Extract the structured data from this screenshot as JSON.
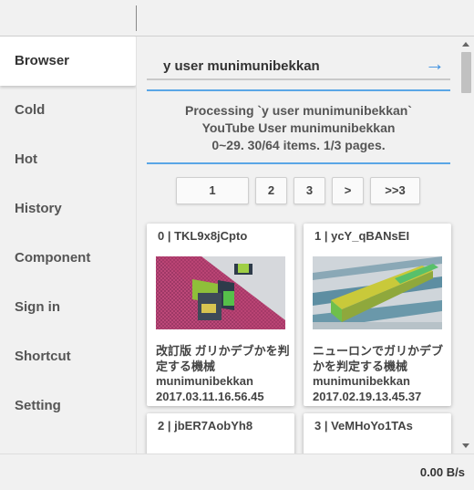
{
  "sidebar": {
    "items": [
      {
        "label": "Browser"
      },
      {
        "label": "Cold"
      },
      {
        "label": "Hot"
      },
      {
        "label": "History"
      },
      {
        "label": "Component"
      },
      {
        "label": "Sign in"
      },
      {
        "label": "Shortcut"
      },
      {
        "label": "Setting"
      }
    ],
    "active_index": 0
  },
  "search": {
    "value": "y user munimunibekkan",
    "go_icon": "arrow-right-icon",
    "go_glyph": "→"
  },
  "status": {
    "line1": "Processing `y user munimunibekkan`",
    "line2": "YouTube User munimunibekkan",
    "line3": "0~29. 30/64 items. 1/3 pages."
  },
  "pager": [
    "1",
    "2",
    "3",
    ">",
    ">>3"
  ],
  "cards": [
    {
      "title": "0 | TKL9x8jCpto",
      "name": "改訂版 ガリかデブかを判定する機械",
      "user": "munimunibekkan",
      "date": "2017.03.11.16.56.45"
    },
    {
      "title": "1 | ycY_qBANsEI",
      "name": "ニューロンでガリかデブかを判定する機械",
      "user": "munimunibekkan",
      "date": "2017.02.19.13.45.37"
    },
    {
      "title": "2 | jbER7AobYh8"
    },
    {
      "title": "3 | VeMHoYo1TAs"
    }
  ],
  "statusbar": {
    "speed": "0.00 B/s"
  },
  "colors": {
    "accent": "#3b8fe0",
    "divider": "#5aa6e6"
  }
}
